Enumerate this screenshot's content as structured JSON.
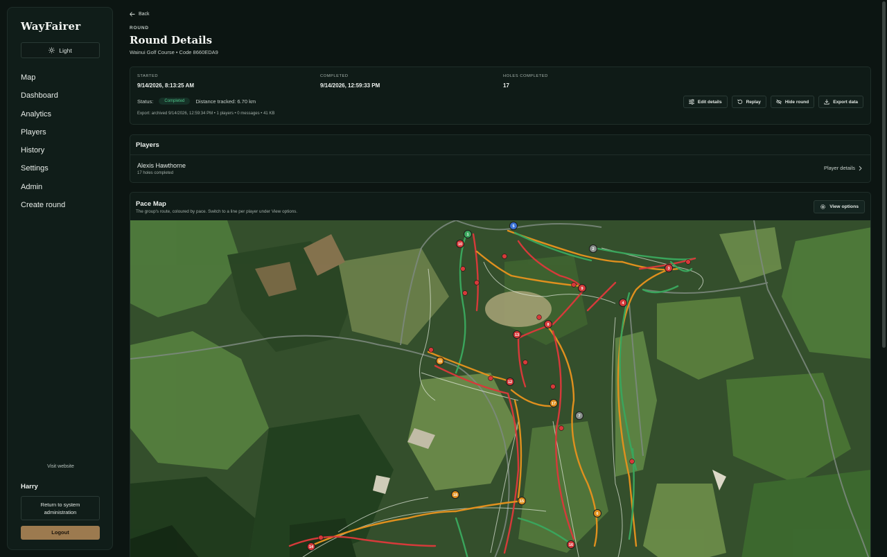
{
  "sidebar": {
    "brand": "WayFairer",
    "theme_label": "Light",
    "nav": [
      "Map",
      "Dashboard",
      "Analytics",
      "Players",
      "History",
      "Settings",
      "Admin",
      "Create round"
    ],
    "visit_label": "Visit website",
    "user_name": "Harry",
    "system_label": "Return to system administration",
    "logout_label": "Logout"
  },
  "header": {
    "back_label": "Back",
    "eyebrow": "ROUND",
    "title": "Round Details",
    "subtitle": "Wainui Golf Course • Code 8660EDA9"
  },
  "summary": {
    "started_label": "STARTED",
    "started_value": "9/14/2026, 8:13:25 AM",
    "completed_label": "COMPLETED",
    "completed_value": "9/14/2026, 12:59:33 PM",
    "holes_label": "HOLES COMPLETED",
    "holes_value": "17",
    "status_label": "Status:",
    "status_badge": "Completed",
    "distance": "Distance tracked: 6.70 km",
    "export_line": "Export: archived 9/14/2026, 12:59:34 PM • 1 players • 0 messages • 41 KB",
    "actions": {
      "edit": "Edit details",
      "replay": "Replay",
      "hide": "Hide round",
      "export": "Export data"
    }
  },
  "players": {
    "heading": "Players",
    "rows": [
      {
        "name": "Alexis Hawthorne",
        "sub": "17 holes completed",
        "link": "Player details"
      }
    ]
  },
  "pace_map": {
    "title": "Pace Map",
    "subtitle": "The group's route, coloured by pace. Switch to a line per player under View options.",
    "view_options": "View options",
    "markers": [
      "1",
      "2",
      "3",
      "4",
      "5",
      "6",
      "7",
      "8",
      "9",
      "10",
      "11",
      "12",
      "13",
      "14",
      "15",
      "16",
      "17",
      "18"
    ]
  },
  "colors": {
    "accent": "#9c7a4f",
    "pace_fast": "#3aa55c",
    "pace_medium": "#e0901e",
    "pace_slow": "#d63a3a",
    "status_completed": "#4ec48a"
  }
}
